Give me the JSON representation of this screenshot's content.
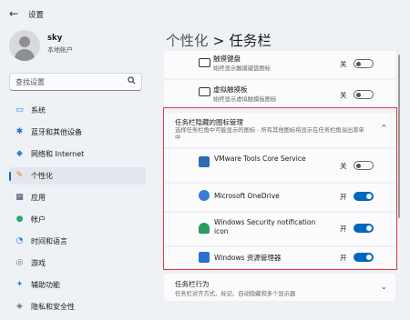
{
  "window": {
    "back_glyph": "←",
    "title": "设置"
  },
  "user": {
    "name": "sky",
    "subtitle": "本地帐户"
  },
  "search": {
    "placeholder": "查找设置"
  },
  "nav": [
    {
      "icon": "system-icon",
      "glyph": "▭",
      "color": "#2b7bd6",
      "label": "系统"
    },
    {
      "icon": "bluetooth-icon",
      "glyph": "✱",
      "color": "#1f6fd1",
      "label": "蓝牙和其他设备"
    },
    {
      "icon": "network-icon",
      "glyph": "◆",
      "color": "#2f86d9",
      "label": "网络和 Internet"
    },
    {
      "icon": "personalization-icon",
      "glyph": "✎",
      "color": "#c9822a",
      "label": "个性化"
    },
    {
      "icon": "apps-icon",
      "glyph": "▦",
      "color": "#3d4b63",
      "label": "应用"
    },
    {
      "icon": "accounts-icon",
      "glyph": "●",
      "color": "#29a96a",
      "label": "帐户"
    },
    {
      "icon": "time-language-icon",
      "glyph": "◔",
      "color": "#2b7bd6",
      "label": "时间和语言"
    },
    {
      "icon": "gaming-icon",
      "glyph": "◎",
      "color": "#6a6f78",
      "label": "游戏"
    },
    {
      "icon": "accessibility-icon",
      "glyph": "✦",
      "color": "#2b7bd6",
      "label": "辅助功能"
    },
    {
      "icon": "privacy-icon",
      "glyph": "◈",
      "color": "#6a6f78",
      "label": "隐私和安全性"
    }
  ],
  "nav_selected": 3,
  "heading": {
    "parent": "个性化",
    "separator": ">",
    "current": "任务栏"
  },
  "pen_rows": [
    {
      "icon": "touch-keyboard-icon",
      "title": "触摸键盘",
      "subtitle": "始终显示触摸键盘图标",
      "state": "关"
    },
    {
      "icon": "virtual-touchpad-icon",
      "title": "虚拟触摸板",
      "subtitle": "始终显示虚拟触摸板图标",
      "state": "关"
    }
  ],
  "overflow_section": {
    "title": "任务栏隐藏的图标管理",
    "subtitle": "选择任务栏角中可能显示的图标 - 所有其他图标将显示在任务栏角溢出菜单中",
    "chevron": "^",
    "items": [
      {
        "icon": "vmware-tools-icon",
        "title": "VMware Tools Core Service",
        "state": "关",
        "on": false,
        "color": "#2c6cb3"
      },
      {
        "icon": "onedrive-icon",
        "title": "Microsoft OneDrive",
        "state": "开",
        "on": true,
        "color": "#3a7bd5"
      },
      {
        "icon": "windows-security-icon",
        "title": "Windows Security notification icon",
        "state": "开",
        "on": true,
        "color": "#2a9d5c"
      },
      {
        "icon": "windows-explorer-icon",
        "title": "Windows 资源管理器",
        "state": "开",
        "on": true,
        "color": "#2b6fd1"
      }
    ]
  },
  "behaviors": {
    "title": "任务栏行为",
    "subtitle": "任务栏对齐方式、标记、自动隐藏和多个显示器"
  }
}
